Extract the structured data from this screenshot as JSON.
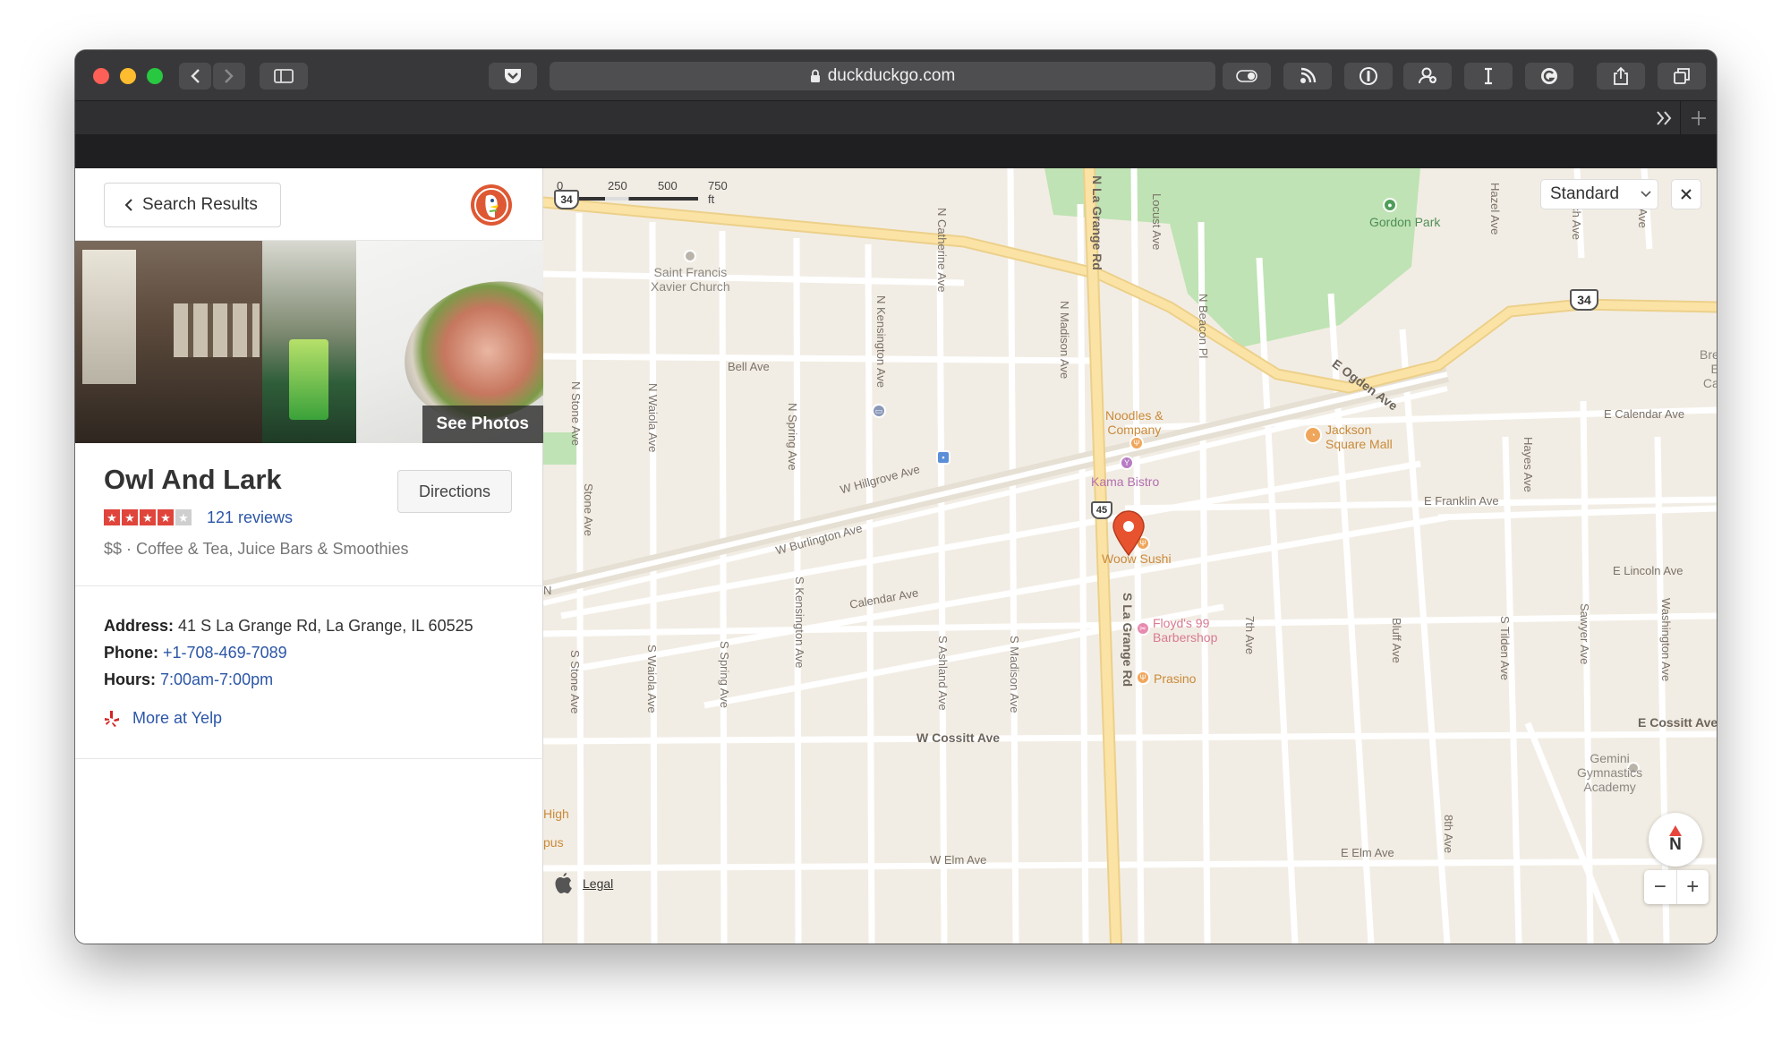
{
  "browser": {
    "url": "duckduckgo.com",
    "overflow_icon": "chevrons-right-icon",
    "new_tab_icon": "plus-icon"
  },
  "panel": {
    "back_label": "Search Results",
    "see_photos": "See Photos",
    "name": "Owl And Lark",
    "directions": "Directions",
    "rating": 4,
    "rating_max": 5,
    "reviews": "121 reviews",
    "categories": "$$ · Coffee & Tea, Juice Bars & Smoothies",
    "address_label": "Address:",
    "address": "41 S La Grange Rd, La Grange, IL 60525",
    "phone_label": "Phone:",
    "phone": "+1-708-469-7089",
    "hours_label": "Hours:",
    "hours": "7:00am-7:00pm",
    "more": "More at Yelp"
  },
  "map": {
    "scale": [
      "0",
      "250",
      "500",
      "750 ft"
    ],
    "map_type": "Standard",
    "compass": "N",
    "legal": "Legal",
    "zoom_out": "−",
    "zoom_in": "+",
    "shields": [
      "34",
      "34",
      "45"
    ],
    "streets": {
      "n_la_grange": "N La Grange Rd",
      "s_la_grange": "S La Grange Rd",
      "locust": "Locust Ave",
      "hazel": "Hazel Ave",
      "beach": "Beach Ave",
      "ogden": "E Ogden Ave",
      "catherine": "N Catherine Ave",
      "kensington_n": "N Kensington Ave",
      "madison_n": "N Madison Ave",
      "beacon": "N Beacon Pl",
      "bell": "Bell Ave",
      "stone_n": "N Stone Ave",
      "waiola_n": "N Waiola Ave",
      "spring_n": "N Spring Ave",
      "hillgrove": "W Hillgrove Ave",
      "burlington": "W Burlington Ave",
      "calendar": "Calendar Ave",
      "calendar_e": "E Calendar Ave",
      "franklin": "E Franklin Ave",
      "lincoln": "E Lincoln Ave",
      "cossitt_w": "W Cossitt Ave",
      "cossitt_e": "E Cossitt Ave",
      "elm_w": "W Elm Ave",
      "elm_e": "E Elm Ave",
      "stone_s": "S Stone Ave",
      "stone": "Stone Ave",
      "waiola_s": "S Waiola Ave",
      "spring_s": "S Spring Ave",
      "kensington_s": "S Kensington Ave",
      "ashland_s": "S Ashland Ave",
      "madison_s": "S Madison Ave",
      "seventh": "7th Ave",
      "eighth": "8th Ave",
      "bluff": "Bluff Ave",
      "tilden": "S Tilden Ave",
      "sawyer": "Sawyer Ave",
      "washington": "Washington Ave",
      "hayes": "Hayes Ave",
      "vine": "Vine Ave"
    },
    "places": {
      "gordon": "Gordon Park",
      "saint_francis_1": "Saint Francis",
      "saint_francis_2": "Xavier Church",
      "noodles_1": "Noodles &",
      "noodles_2": "Company",
      "kama": "Kama Bistro",
      "jackson_1": "Jackson",
      "jackson_2": "Square Mall",
      "woow": "Woow Sushi",
      "floyds_1": "Floyd's 99",
      "floyds_2": "Barbershop",
      "prasino": "Prasino",
      "gemini_1": "Gemini",
      "gemini_2": "Gymnastics",
      "gemini_3": "Academy",
      "high_1": "High",
      "high_2": "pus",
      "edge_1": "Bre",
      "edge_2": "E",
      "edge_3": "Ca",
      "edge_n": "N"
    },
    "colors": {
      "land": "#f2ede4",
      "road": "#ffffff",
      "highway": "#fbe3a6",
      "park": "#bfe3b4",
      "pin": "#e8532f"
    }
  }
}
